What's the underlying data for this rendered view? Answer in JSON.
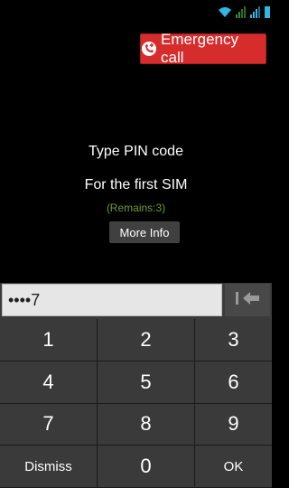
{
  "status_bar": {
    "icons": [
      "wifi-icon",
      "signal-icon",
      "signal-icon",
      "battery-icon"
    ]
  },
  "emergency_button": {
    "label": "Emergency call",
    "color": "#d62c2c"
  },
  "prompt": {
    "title": "Type PIN code",
    "sim_label": "For the first SIM",
    "remains": "(Remains:3)",
    "more_info": "More Info"
  },
  "pin_entry": {
    "value": "••••7"
  },
  "keypad": {
    "keys": [
      "1",
      "2",
      "3",
      "4",
      "5",
      "6",
      "7",
      "8",
      "9",
      "Dismiss",
      "0",
      "OK"
    ]
  },
  "colors": {
    "accent": "#d62c2c",
    "remains_text": "#6f9b2f"
  }
}
